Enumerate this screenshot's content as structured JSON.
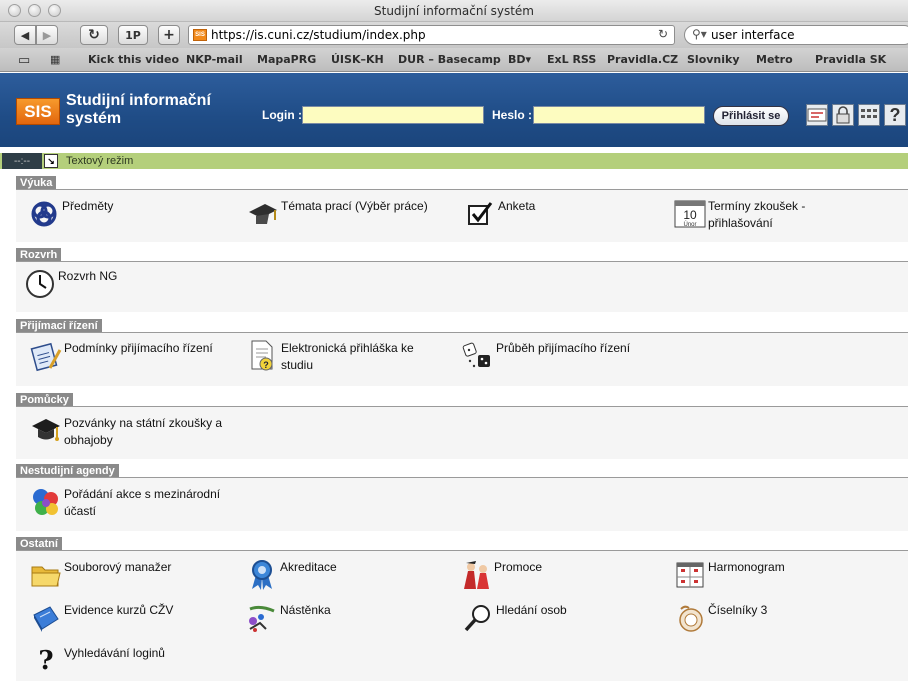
{
  "browser": {
    "window_title": "Studijní informační systém",
    "url": "https://is.cuni.cz/studium/index.php",
    "search_value": "user interface",
    "nav": {
      "back": "◀",
      "forward": "▶",
      "reload": "↻",
      "one_p": "1P",
      "add": "+"
    },
    "bookmarks": [
      "Kick this video",
      "NKP-mail",
      "MapaPRG",
      "ÚISK–KH",
      "DUR – Basecamp",
      "BD▾",
      "ExL RSS",
      "Pravidla.CZ",
      "Slovniky",
      "Metro",
      "Pravidla SK"
    ]
  },
  "header": {
    "logo": "SIS",
    "title_line1": "Studijní informační",
    "title_line2": "systém",
    "login_label": "Login :",
    "password_label": "Heslo :",
    "login_button": "Přihlásit se"
  },
  "mode_bar": {
    "clock": "--:--",
    "toggle": "↘",
    "text": "Textový režim"
  },
  "sections": {
    "vyuka": {
      "title": "Výuka",
      "items": [
        {
          "line1": "Předměty",
          "line2": ""
        },
        {
          "line1": "Témata prací (Výběr práce)",
          "line2": ""
        },
        {
          "line1": "Anketa",
          "line2": ""
        },
        {
          "line1": "Termíny zkoušek -",
          "line2": "přihlašování"
        }
      ]
    },
    "rozvrh": {
      "title": "Rozvrh",
      "items": [
        {
          "line1": "Rozvrh NG",
          "line2": ""
        }
      ]
    },
    "prijimaci": {
      "title": "Přijímací řízení",
      "items": [
        {
          "line1": "Podmínky přijímacího řízení",
          "line2": ""
        },
        {
          "line1": "Elektronická přihláška ke",
          "line2": "studiu"
        },
        {
          "line1": "Průběh přijímacího řízení",
          "line2": ""
        }
      ]
    },
    "pomucky": {
      "title": "Pomůcky",
      "items": [
        {
          "line1": "Pozvánky na státní zkoušky a",
          "line2": "obhajoby"
        }
      ]
    },
    "nestudijni": {
      "title": "Nestudijní agendy",
      "items": [
        {
          "line1": "Pořádání akce s mezinárodní",
          "line2": "účastí"
        }
      ]
    },
    "ostatni": {
      "title": "Ostatní",
      "items": [
        {
          "line1": "Souborový manažer",
          "line2": ""
        },
        {
          "line1": "Akreditace",
          "line2": ""
        },
        {
          "line1": "Promoce",
          "line2": ""
        },
        {
          "line1": "Harmonogram",
          "line2": ""
        },
        {
          "line1": "Evidence kurzů CŽV",
          "line2": ""
        },
        {
          "line1": "Nástěnka",
          "line2": ""
        },
        {
          "line1": "Hledání osob",
          "line2": ""
        },
        {
          "line1": "Číselníky 3",
          "line2": ""
        },
        {
          "line1": "Vyhledávání loginů",
          "line2": ""
        }
      ]
    }
  },
  "calendar_icon_number": "10",
  "calendar_icon_month": "Únor",
  "colors": {
    "header_blue": "#1f4c86",
    "mode_bar_green": "#b4cf7b",
    "logo_orange": "#e2660e",
    "section_grey": "#8a8a8a"
  }
}
